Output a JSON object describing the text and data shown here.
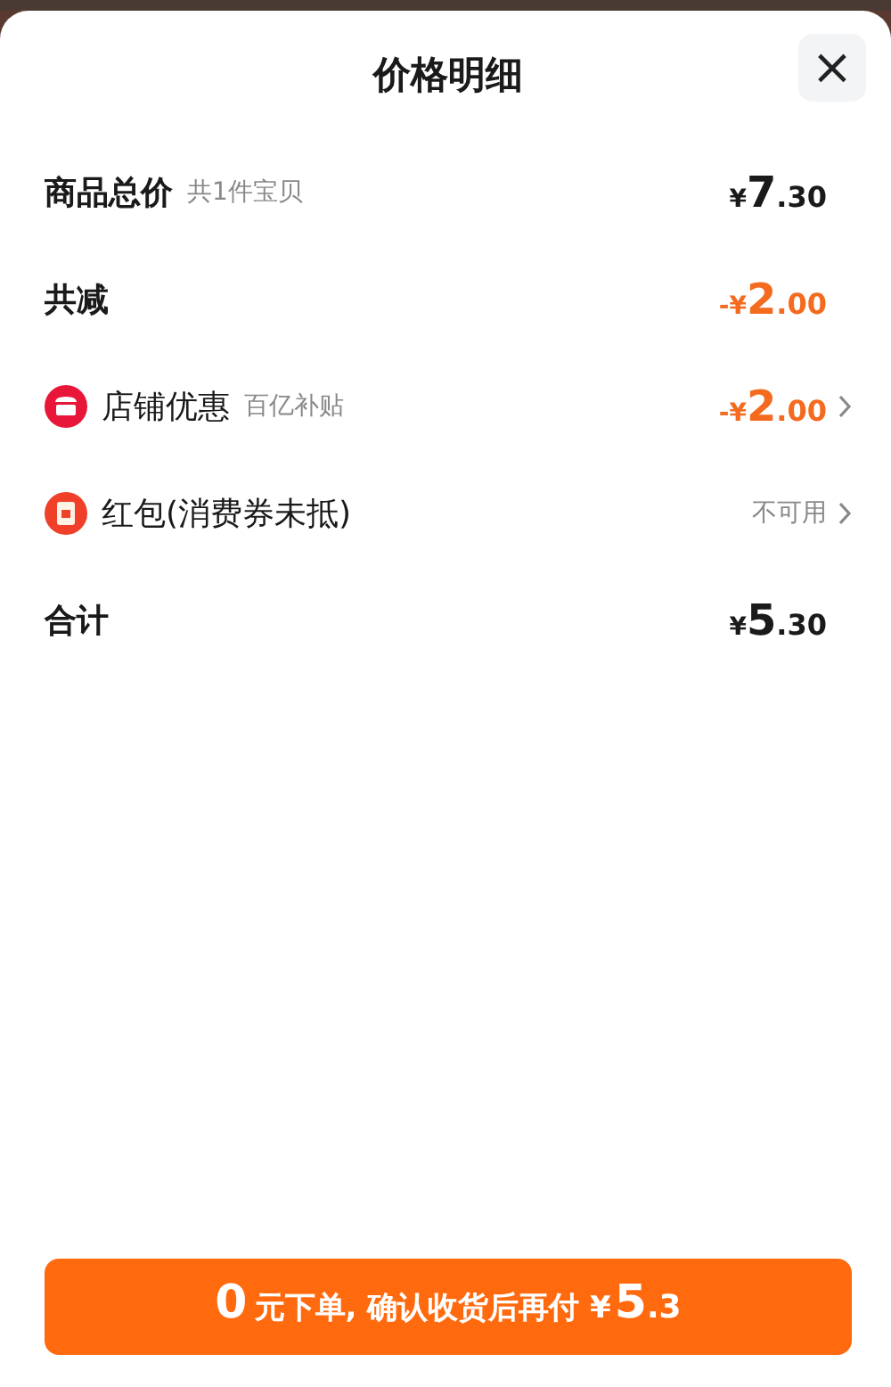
{
  "sheet": {
    "title": "价格明细",
    "close": "×"
  },
  "rows": [
    {
      "kind": "summary",
      "label": "商品总价",
      "note": "共1件宝贝",
      "amount": {
        "prefix": "¥",
        "main": "7",
        "fraction": ".30"
      },
      "color": "#1a1a1a",
      "chevron": false
    },
    {
      "kind": "summary",
      "label": "共减",
      "amount": {
        "prefix": "-¥",
        "main": "2",
        "fraction": ".00"
      },
      "color": "#f46a1f",
      "chevron": false
    },
    {
      "kind": "shop",
      "label": "店铺优惠",
      "note": "百亿补贴",
      "amount": {
        "prefix": "-¥",
        "main": "2",
        "fraction": ".00"
      },
      "color": "#f46a1f",
      "chevron": true
    },
    {
      "kind": "envelope",
      "label": "红包(消费券未抵)",
      "status": "不可用",
      "color": "#888888",
      "chevron": true
    },
    {
      "kind": "summary",
      "label": "合计",
      "amount": {
        "prefix": "¥",
        "main": "5",
        "fraction": ".30"
      },
      "color": "#1a1a1a",
      "chevron": false
    }
  ],
  "submit_button": {
    "lead": "0",
    "text": "元下单, 确认收货后再付 ¥",
    "main": "5",
    "fraction": ".3"
  }
}
